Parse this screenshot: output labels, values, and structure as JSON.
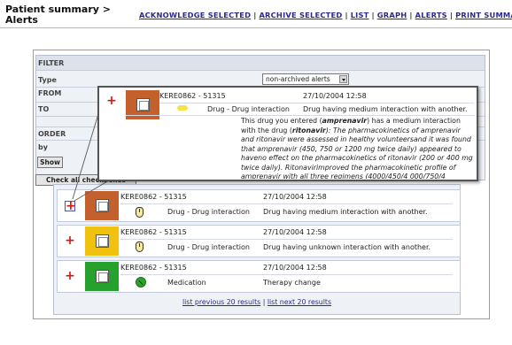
{
  "header": {
    "title": "Patient summary > Alerts",
    "nav": {
      "acknowledge": "ACKNOWLEDGE SELECTED",
      "archive": "ARCHIVE SELECTED",
      "list": "LIST",
      "graph": "GRAPH",
      "alerts": "ALERTS",
      "print_summary": "PRINT SUMMARY",
      "separator": "|"
    }
  },
  "filter": {
    "section_label": "FILTER",
    "type_label": "Type",
    "type_value": "non-archived alerts",
    "from_label": "FROM",
    "to_label": "TO",
    "order_label": "ORDER",
    "by_label": "by",
    "show_button": "Show",
    "check_all_button": "Check all checkboxes"
  },
  "popup": {
    "id": "KERE0862 - 51315",
    "datetime": "27/10/2004 12:58",
    "category": "Drug - Drug interaction",
    "summary": "Drug having medium interaction with another.",
    "detail_intro": "This drug you entered (",
    "drug1": "amprenavir",
    "detail_mid": ") has a medium interaction with the drug (",
    "drug2": "ritonavir",
    "detail_body": "): The pharmacokinetics of amprenavir and ritonavir were assessed in healthy volunteersand it was found that amprenavir (450, 750 or 1200 mg twice daily) appeared to haveno effect on the pharmacokinetics of ritonavir (200 or 400 mg twice daily). Ritonavirimproved the pharmacokinetic profile of amprenavir with all three regimens (4000/450/4 000/750/4 2000/12004) yielding higher AUC and"
  },
  "alerts": [
    {
      "id": "KERE0862 - 51315",
      "datetime": "27/10/2004 12:58",
      "category": "Drug - Drug interaction",
      "summary": "Drug having medium interaction with another.",
      "severity_color": "#c4602c",
      "icon": "mouse-icon"
    },
    {
      "id": "KERE0862 - 51315",
      "datetime": "27/10/2004 12:58",
      "category": "Drug - Drug interaction",
      "summary": "Drug having unknown interaction with another.",
      "severity_color": "#f1c20d",
      "icon": "mouse-icon"
    },
    {
      "id": "KERE0862 - 51315",
      "datetime": "27/10/2004 12:58",
      "category": "Medication",
      "summary": "Therapy change",
      "severity_color": "#27a12e",
      "icon": "pill-icon"
    }
  ],
  "pager": {
    "previous": "list previous 20 results",
    "separator": "|",
    "next": "list next 20 results"
  }
}
